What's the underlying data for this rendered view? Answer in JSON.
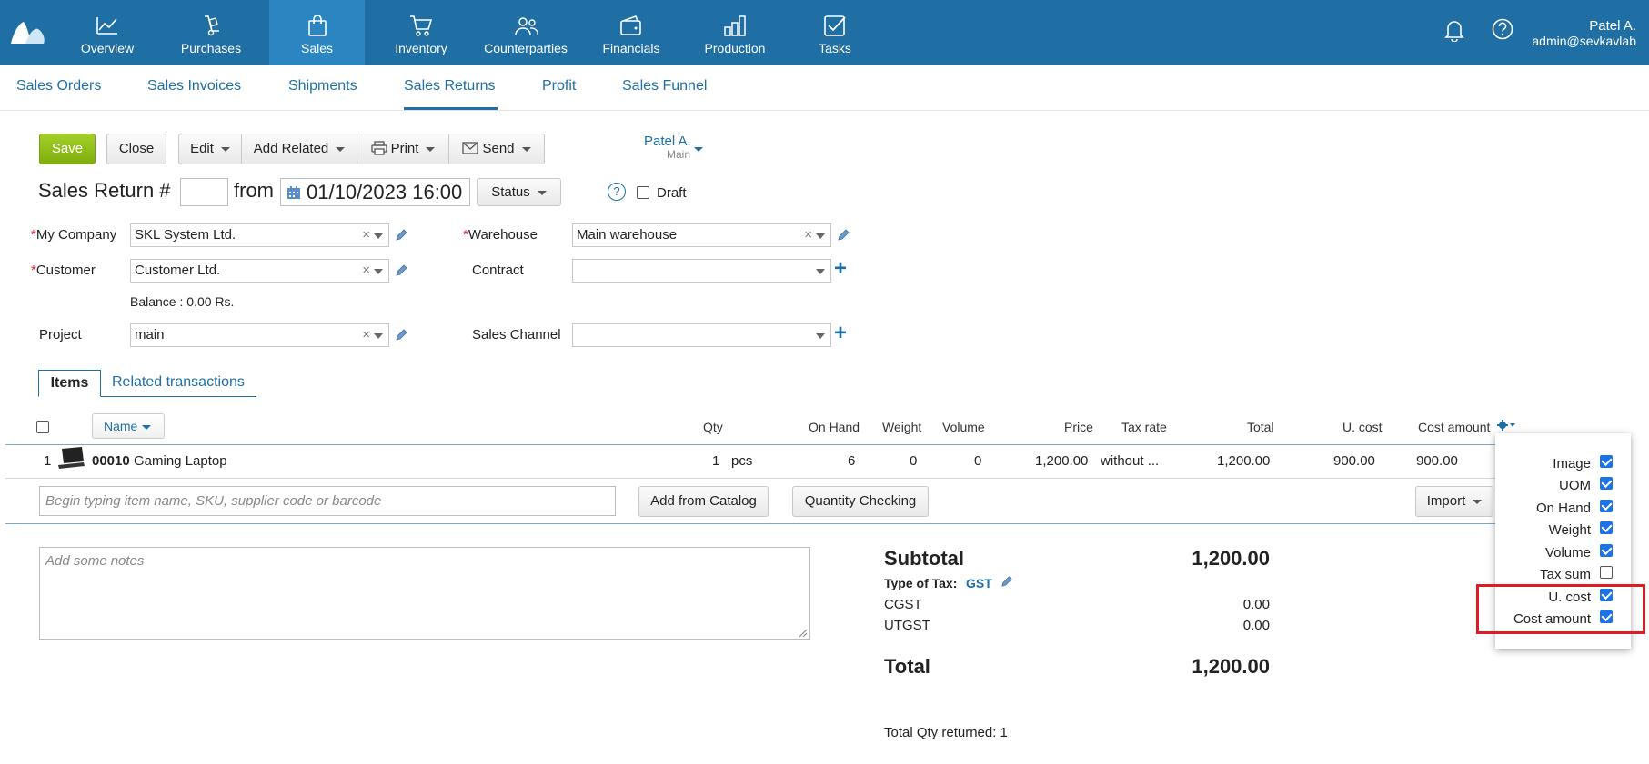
{
  "topnav": {
    "items": [
      {
        "label": "Overview",
        "icon": "chart-line-icon"
      },
      {
        "label": "Purchases",
        "icon": "hand-truck-icon"
      },
      {
        "label": "Sales",
        "icon": "shopping-bag-icon"
      },
      {
        "label": "Inventory",
        "icon": "cart-icon"
      },
      {
        "label": "Counterparties",
        "icon": "people-icon"
      },
      {
        "label": "Financials",
        "icon": "wallet-icon"
      },
      {
        "label": "Production",
        "icon": "factory-icon"
      },
      {
        "label": "Tasks",
        "icon": "checkbox-icon"
      }
    ],
    "active": "Sales",
    "user_name": "Patel A.",
    "user_email": "admin@sevkavlab",
    "brand_color": "#1f6fa5"
  },
  "subnav": {
    "items": [
      "Sales Orders",
      "Sales Invoices",
      "Shipments",
      "Sales Returns",
      "Profit",
      "Sales Funnel"
    ],
    "active": "Sales Returns"
  },
  "toolbar": {
    "save": "Save",
    "close": "Close",
    "edit": "Edit",
    "add_related": "Add Related",
    "print": "Print",
    "send": "Send",
    "owner_name": "Patel A.",
    "owner_dept": "Main"
  },
  "doc": {
    "title": "Sales Return #",
    "from": "from",
    "date": "01/10/2023 16:00",
    "status": "Status",
    "help": "?",
    "draft": "Draft"
  },
  "form": {
    "my_company_label": "My Company",
    "my_company_value": "SKL System Ltd.",
    "warehouse_label": "Warehouse",
    "warehouse_value": "Main warehouse",
    "customer_label": "Customer",
    "customer_value": "Customer Ltd.",
    "contract_label": "Contract",
    "balance": "Balance : 0.00 Rs.",
    "project_label": "Project",
    "project_value": "main",
    "sales_channel_label": "Sales Channel"
  },
  "tabs": {
    "items": "Items",
    "related": "Related transactions"
  },
  "table": {
    "headers": {
      "name": "Name",
      "qty": "Qty",
      "on_hand": "On Hand",
      "weight": "Weight",
      "volume": "Volume",
      "price": "Price",
      "tax_rate": "Tax rate",
      "total": "Total",
      "u_cost": "U. cost",
      "cost_amount": "Cost amount"
    },
    "rows": [
      {
        "index": "1",
        "sku": "00010",
        "name": "Gaming Laptop",
        "qty": "1",
        "uom": "pcs",
        "on_hand": "6",
        "weight": "0",
        "volume": "0",
        "price": "1,200.00",
        "tax_rate": "without ...",
        "total": "1,200.00",
        "u_cost": "900.00",
        "cost_amount": "900.00"
      }
    ],
    "search_placeholder": "Begin typing item name, SKU, supplier code or barcode",
    "add_from_catalog": "Add from Catalog",
    "quantity_checking": "Quantity Checking",
    "import": "Import"
  },
  "notes_placeholder": "Add some notes",
  "totals": {
    "subtotal_label": "Subtotal",
    "subtotal_value": "1,200.00",
    "tax_type_label": "Type of Tax:",
    "tax_type_value": "GST",
    "cgst_label": "CGST",
    "cgst_value": "0.00",
    "utgst_label": "UTGST",
    "utgst_value": "0.00",
    "total_label": "Total",
    "total_value": "1,200.00",
    "qty_returned": "Total Qty returned: 1"
  },
  "column_popup": {
    "items": [
      {
        "label": "Image",
        "checked": true
      },
      {
        "label": "UOM",
        "checked": true
      },
      {
        "label": "On Hand",
        "checked": true
      },
      {
        "label": "Weight",
        "checked": true
      },
      {
        "label": "Volume",
        "checked": true
      },
      {
        "label": "Tax sum",
        "checked": false
      },
      {
        "label": "U. cost",
        "checked": true
      },
      {
        "label": "Cost amount",
        "checked": true
      }
    ],
    "highlight_color": "#e01b24"
  }
}
